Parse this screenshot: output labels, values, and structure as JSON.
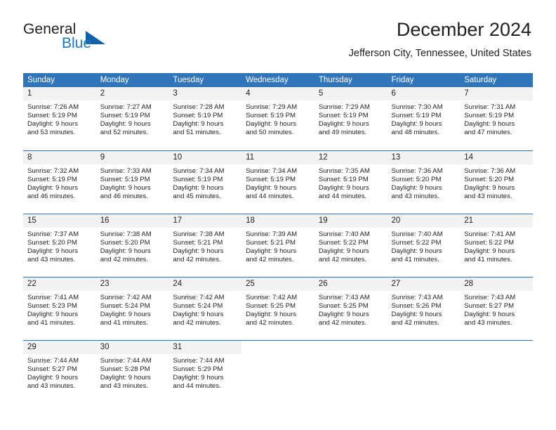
{
  "brand": {
    "name_part1": "General",
    "name_part2": "Blue",
    "logo_icon": "triangle-logo-icon"
  },
  "header": {
    "title": "December 2024",
    "subtitle": "Jefferson City, Tennessee, United States"
  },
  "colors": {
    "header_blue": "#3075ba",
    "day_band_gray": "#f2f2f2",
    "brand_blue": "#1b78c2",
    "text": "#231f20"
  },
  "weekdays": [
    "Sunday",
    "Monday",
    "Tuesday",
    "Wednesday",
    "Thursday",
    "Friday",
    "Saturday"
  ],
  "weeks": [
    [
      {
        "day": "1",
        "sunrise": "Sunrise: 7:26 AM",
        "sunset": "Sunset: 5:19 PM",
        "daylight_line1": "Daylight: 9 hours",
        "daylight_line2": "and 53 minutes."
      },
      {
        "day": "2",
        "sunrise": "Sunrise: 7:27 AM",
        "sunset": "Sunset: 5:19 PM",
        "daylight_line1": "Daylight: 9 hours",
        "daylight_line2": "and 52 minutes."
      },
      {
        "day": "3",
        "sunrise": "Sunrise: 7:28 AM",
        "sunset": "Sunset: 5:19 PM",
        "daylight_line1": "Daylight: 9 hours",
        "daylight_line2": "and 51 minutes."
      },
      {
        "day": "4",
        "sunrise": "Sunrise: 7:29 AM",
        "sunset": "Sunset: 5:19 PM",
        "daylight_line1": "Daylight: 9 hours",
        "daylight_line2": "and 50 minutes."
      },
      {
        "day": "5",
        "sunrise": "Sunrise: 7:29 AM",
        "sunset": "Sunset: 5:19 PM",
        "daylight_line1": "Daylight: 9 hours",
        "daylight_line2": "and 49 minutes."
      },
      {
        "day": "6",
        "sunrise": "Sunrise: 7:30 AM",
        "sunset": "Sunset: 5:19 PM",
        "daylight_line1": "Daylight: 9 hours",
        "daylight_line2": "and 48 minutes."
      },
      {
        "day": "7",
        "sunrise": "Sunrise: 7:31 AM",
        "sunset": "Sunset: 5:19 PM",
        "daylight_line1": "Daylight: 9 hours",
        "daylight_line2": "and 47 minutes."
      }
    ],
    [
      {
        "day": "8",
        "sunrise": "Sunrise: 7:32 AM",
        "sunset": "Sunset: 5:19 PM",
        "daylight_line1": "Daylight: 9 hours",
        "daylight_line2": "and 46 minutes."
      },
      {
        "day": "9",
        "sunrise": "Sunrise: 7:33 AM",
        "sunset": "Sunset: 5:19 PM",
        "daylight_line1": "Daylight: 9 hours",
        "daylight_line2": "and 46 minutes."
      },
      {
        "day": "10",
        "sunrise": "Sunrise: 7:34 AM",
        "sunset": "Sunset: 5:19 PM",
        "daylight_line1": "Daylight: 9 hours",
        "daylight_line2": "and 45 minutes."
      },
      {
        "day": "11",
        "sunrise": "Sunrise: 7:34 AM",
        "sunset": "Sunset: 5:19 PM",
        "daylight_line1": "Daylight: 9 hours",
        "daylight_line2": "and 44 minutes."
      },
      {
        "day": "12",
        "sunrise": "Sunrise: 7:35 AM",
        "sunset": "Sunset: 5:19 PM",
        "daylight_line1": "Daylight: 9 hours",
        "daylight_line2": "and 44 minutes."
      },
      {
        "day": "13",
        "sunrise": "Sunrise: 7:36 AM",
        "sunset": "Sunset: 5:20 PM",
        "daylight_line1": "Daylight: 9 hours",
        "daylight_line2": "and 43 minutes."
      },
      {
        "day": "14",
        "sunrise": "Sunrise: 7:36 AM",
        "sunset": "Sunset: 5:20 PM",
        "daylight_line1": "Daylight: 9 hours",
        "daylight_line2": "and 43 minutes."
      }
    ],
    [
      {
        "day": "15",
        "sunrise": "Sunrise: 7:37 AM",
        "sunset": "Sunset: 5:20 PM",
        "daylight_line1": "Daylight: 9 hours",
        "daylight_line2": "and 43 minutes."
      },
      {
        "day": "16",
        "sunrise": "Sunrise: 7:38 AM",
        "sunset": "Sunset: 5:20 PM",
        "daylight_line1": "Daylight: 9 hours",
        "daylight_line2": "and 42 minutes."
      },
      {
        "day": "17",
        "sunrise": "Sunrise: 7:38 AM",
        "sunset": "Sunset: 5:21 PM",
        "daylight_line1": "Daylight: 9 hours",
        "daylight_line2": "and 42 minutes."
      },
      {
        "day": "18",
        "sunrise": "Sunrise: 7:39 AM",
        "sunset": "Sunset: 5:21 PM",
        "daylight_line1": "Daylight: 9 hours",
        "daylight_line2": "and 42 minutes."
      },
      {
        "day": "19",
        "sunrise": "Sunrise: 7:40 AM",
        "sunset": "Sunset: 5:22 PM",
        "daylight_line1": "Daylight: 9 hours",
        "daylight_line2": "and 42 minutes."
      },
      {
        "day": "20",
        "sunrise": "Sunrise: 7:40 AM",
        "sunset": "Sunset: 5:22 PM",
        "daylight_line1": "Daylight: 9 hours",
        "daylight_line2": "and 41 minutes."
      },
      {
        "day": "21",
        "sunrise": "Sunrise: 7:41 AM",
        "sunset": "Sunset: 5:22 PM",
        "daylight_line1": "Daylight: 9 hours",
        "daylight_line2": "and 41 minutes."
      }
    ],
    [
      {
        "day": "22",
        "sunrise": "Sunrise: 7:41 AM",
        "sunset": "Sunset: 5:23 PM",
        "daylight_line1": "Daylight: 9 hours",
        "daylight_line2": "and 41 minutes."
      },
      {
        "day": "23",
        "sunrise": "Sunrise: 7:42 AM",
        "sunset": "Sunset: 5:24 PM",
        "daylight_line1": "Daylight: 9 hours",
        "daylight_line2": "and 41 minutes."
      },
      {
        "day": "24",
        "sunrise": "Sunrise: 7:42 AM",
        "sunset": "Sunset: 5:24 PM",
        "daylight_line1": "Daylight: 9 hours",
        "daylight_line2": "and 42 minutes."
      },
      {
        "day": "25",
        "sunrise": "Sunrise: 7:42 AM",
        "sunset": "Sunset: 5:25 PM",
        "daylight_line1": "Daylight: 9 hours",
        "daylight_line2": "and 42 minutes."
      },
      {
        "day": "26",
        "sunrise": "Sunrise: 7:43 AM",
        "sunset": "Sunset: 5:25 PM",
        "daylight_line1": "Daylight: 9 hours",
        "daylight_line2": "and 42 minutes."
      },
      {
        "day": "27",
        "sunrise": "Sunrise: 7:43 AM",
        "sunset": "Sunset: 5:26 PM",
        "daylight_line1": "Daylight: 9 hours",
        "daylight_line2": "and 42 minutes."
      },
      {
        "day": "28",
        "sunrise": "Sunrise: 7:43 AM",
        "sunset": "Sunset: 5:27 PM",
        "daylight_line1": "Daylight: 9 hours",
        "daylight_line2": "and 43 minutes."
      }
    ],
    [
      {
        "day": "29",
        "sunrise": "Sunrise: 7:44 AM",
        "sunset": "Sunset: 5:27 PM",
        "daylight_line1": "Daylight: 9 hours",
        "daylight_line2": "and 43 minutes."
      },
      {
        "day": "30",
        "sunrise": "Sunrise: 7:44 AM",
        "sunset": "Sunset: 5:28 PM",
        "daylight_line1": "Daylight: 9 hours",
        "daylight_line2": "and 43 minutes."
      },
      {
        "day": "31",
        "sunrise": "Sunrise: 7:44 AM",
        "sunset": "Sunset: 5:29 PM",
        "daylight_line1": "Daylight: 9 hours",
        "daylight_line2": "and 44 minutes."
      },
      {
        "day": "",
        "sunrise": "",
        "sunset": "",
        "daylight_line1": "",
        "daylight_line2": ""
      },
      {
        "day": "",
        "sunrise": "",
        "sunset": "",
        "daylight_line1": "",
        "daylight_line2": ""
      },
      {
        "day": "",
        "sunrise": "",
        "sunset": "",
        "daylight_line1": "",
        "daylight_line2": ""
      },
      {
        "day": "",
        "sunrise": "",
        "sunset": "",
        "daylight_line1": "",
        "daylight_line2": ""
      }
    ]
  ]
}
